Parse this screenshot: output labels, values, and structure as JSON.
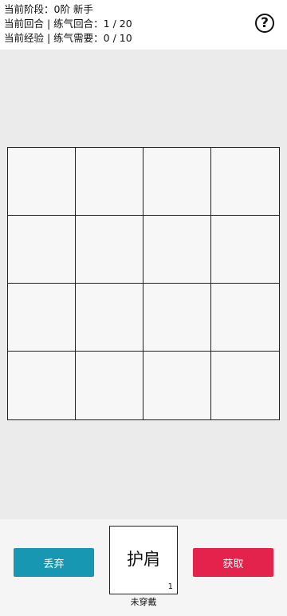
{
  "stats": {
    "stage": "当前阶段：0阶 新手",
    "round": "当前回合 | 练气回合：1 / 20",
    "experience": "当前经验 | 练气需要：0 / 10"
  },
  "help": {
    "icon": "question-circle-icon",
    "glyph": "?"
  },
  "board": {
    "rows": 4,
    "cols": 4
  },
  "actions": {
    "discard_label": "丢弃",
    "obtain_label": "获取"
  },
  "item": {
    "name": "护肩",
    "count": "1",
    "status": "未穿戴"
  },
  "colors": {
    "discard": "#1797b1",
    "obtain": "#e3234c",
    "board_bg": "#ebebeb"
  }
}
